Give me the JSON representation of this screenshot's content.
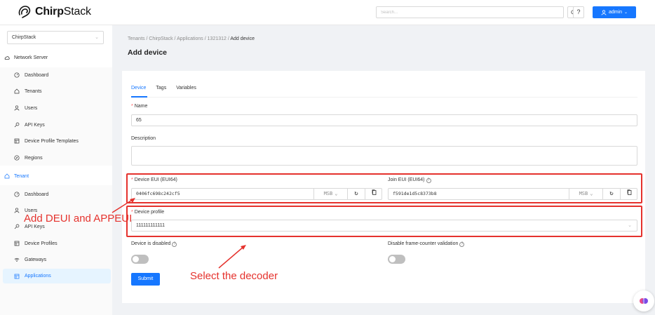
{
  "header": {
    "brand_prefix": "Chirp",
    "brand_suffix": "Stack",
    "search_placeholder": "Search...",
    "help_label": "?",
    "user_label": "admin",
    "accent_color": "#1677ff"
  },
  "sidebar": {
    "tenant_selector": "ChirpStack",
    "network_server_title": "Network Server",
    "network_items": [
      {
        "label": "Dashboard",
        "icon": "dashboard-icon"
      },
      {
        "label": "Tenants",
        "icon": "home-icon"
      },
      {
        "label": "Users",
        "icon": "user-icon"
      },
      {
        "label": "API Keys",
        "icon": "key-icon"
      },
      {
        "label": "Device Profile Templates",
        "icon": "template-icon"
      },
      {
        "label": "Regions",
        "icon": "compass-icon"
      }
    ],
    "tenant_title": "Tenant",
    "tenant_items": [
      {
        "label": "Dashboard",
        "icon": "dashboard-icon"
      },
      {
        "label": "Users",
        "icon": "user-icon"
      },
      {
        "label": "API Keys",
        "icon": "key-icon"
      },
      {
        "label": "Device Profiles",
        "icon": "profile-icon"
      },
      {
        "label": "Gateways",
        "icon": "wifi-icon"
      },
      {
        "label": "Applications",
        "icon": "apps-icon"
      }
    ]
  },
  "breadcrumb": [
    "Tenants",
    "ChirpStack",
    "Applications",
    "1321312",
    "Add device"
  ],
  "page_title": "Add device",
  "tabs": [
    "Device",
    "Tags",
    "Variables"
  ],
  "form": {
    "name_label": "Name",
    "name_value": "65",
    "description_label": "Description",
    "description_value": "",
    "dev_eui_label": "Device EUI (EUI64)",
    "dev_eui_value": "0406fc698c242cf5",
    "join_eui_label": "Join EUI (EUI64)",
    "join_eui_value": "f591de1d5c8373b8",
    "byte_order": "MSB",
    "device_profile_label": "Device profile",
    "device_profile_value": "111111111111",
    "disabled_label": "Device is disabled",
    "fcnt_label": "Disable frame-counter validation",
    "submit_label": "Submit"
  },
  "annotations": {
    "deui_note": "Add DEUI and APPEUI",
    "decoder_note": "Select the decoder",
    "color": "#e5322d"
  }
}
